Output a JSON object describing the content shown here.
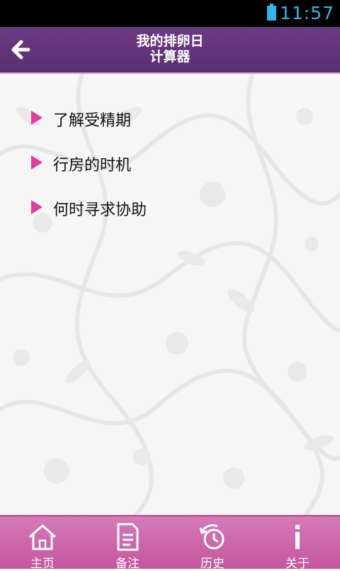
{
  "status_bar": {
    "time": "11:57",
    "battery_icon": "battery-icon"
  },
  "header": {
    "back_icon": "arrow-left-icon",
    "title_line1": "我的排卵日",
    "title_line2": "计算器"
  },
  "menu": {
    "items": [
      {
        "label": "了解受精期",
        "icon": "triangle-right-icon"
      },
      {
        "label": "行房的时机",
        "icon": "triangle-right-icon"
      },
      {
        "label": "何时寻求协助",
        "icon": "triangle-right-icon"
      }
    ]
  },
  "bottom_nav": {
    "items": [
      {
        "label": "主页",
        "icon": "home-icon"
      },
      {
        "label": "备注",
        "icon": "note-icon"
      },
      {
        "label": "历史",
        "icon": "history-icon"
      },
      {
        "label": "关于",
        "icon": "info-icon"
      }
    ]
  },
  "colors": {
    "header_bg": "#5f3178",
    "accent_pink": "#e33c9d",
    "bottom_bar": "#cc64a9",
    "status_text": "#33b5e5"
  }
}
